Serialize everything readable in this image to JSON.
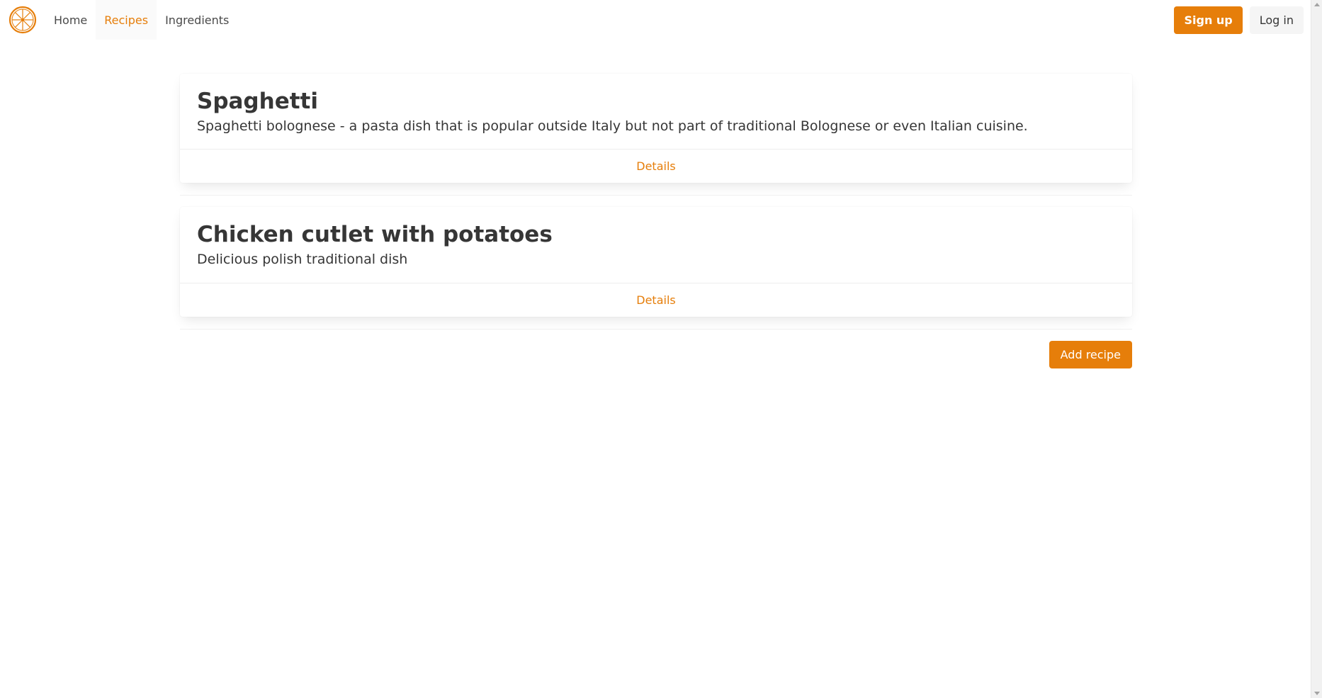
{
  "nav": {
    "logo_icon": "orange-slice-icon",
    "items": [
      {
        "label": "Home"
      },
      {
        "label": "Recipes",
        "active": true
      },
      {
        "label": "Ingredients"
      }
    ],
    "signup_label": "Sign up",
    "login_label": "Log in"
  },
  "recipes": [
    {
      "title": "Spaghetti",
      "description": "Spaghetti bolognese - a pasta dish that is popular outside Italy but not part of traditional Bolognese or even Italian cuisine.",
      "details_label": "Details"
    },
    {
      "title": "Chicken cutlet with potatoes",
      "description": "Delicious polish traditional dish",
      "details_label": "Details"
    }
  ],
  "add_recipe_label": "Add recipe",
  "colors": {
    "accent": "#e67e0a",
    "text": "#363636",
    "background": "#ffffff"
  }
}
